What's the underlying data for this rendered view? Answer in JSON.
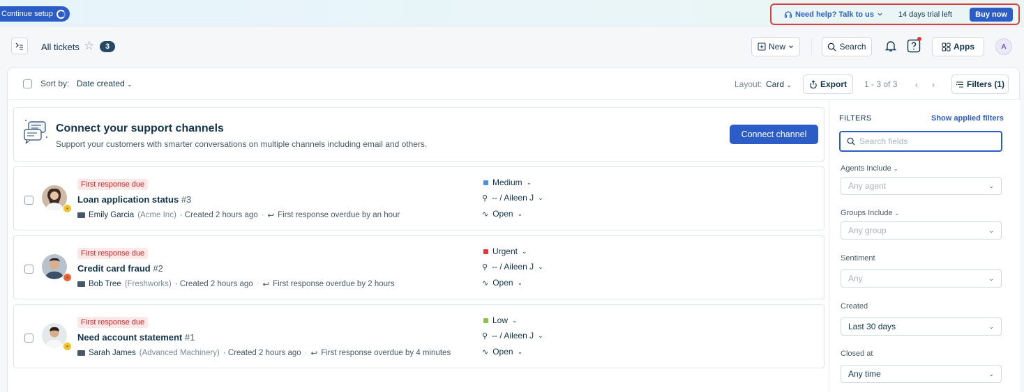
{
  "banner": {
    "continue_setup": "Continue setup",
    "help_link": "Need help? Talk to us",
    "trial_text": "14 days trial left",
    "buy_now": "Buy now"
  },
  "header": {
    "title": "All tickets",
    "count": "3",
    "new_label": "New",
    "search_label": "Search",
    "apps_label": "Apps",
    "avatar_initial": "A"
  },
  "toolbar": {
    "sort_label": "Sort by:",
    "sort_value": "Date created",
    "layout_label": "Layout:",
    "layout_value": "Card",
    "export_label": "Export",
    "pagination": "1 - 3 of 3",
    "filters_label": "Filters (1)"
  },
  "connect": {
    "title": "Connect your support channels",
    "subtitle": "Support your customers with smarter conversations on multiple channels including email and others.",
    "button": "Connect channel"
  },
  "tickets": [
    {
      "due": "First response due",
      "title": "Loan application status",
      "number": "#3",
      "requester": "Emily Garcia",
      "company": "(Acme Inc)",
      "created": "· Created 2 hours ago",
      "overdue": "First response overdue by an hour",
      "priority": "Medium",
      "priority_color": "#4a90e2",
      "assignee": "-- / Aileen J",
      "status": "Open",
      "sentiment_color": "#f2c230"
    },
    {
      "due": "First response due",
      "title": "Credit card fraud",
      "number": "#2",
      "requester": "Bob Tree",
      "company": "(Freshworks)",
      "created": "· Created 2 hours ago",
      "overdue": "First response overdue by 2 hours",
      "priority": "Urgent",
      "priority_color": "#e43538",
      "assignee": "-- / Aileen J",
      "status": "Open",
      "sentiment_color": "#e8663a"
    },
    {
      "due": "First response due",
      "title": "Need account statement",
      "number": "#1",
      "requester": "Sarah James",
      "company": "(Advanced Machinery)",
      "created": "· Created 2 hours ago",
      "overdue": "First response overdue by 4 minutes",
      "priority": "Low",
      "priority_color": "#8bc34a",
      "assignee": "-- / Aileen J",
      "status": "Open",
      "sentiment_color": "#f2c230"
    }
  ],
  "filters": {
    "heading": "FILTERS",
    "show_applied": "Show applied filters",
    "search_placeholder": "Search fields",
    "agents_label": "Agents Include",
    "agents_value": "Any agent",
    "groups_label": "Groups Include",
    "groups_value": "Any group",
    "sentiment_label": "Sentiment",
    "sentiment_value": "Any",
    "created_label": "Created",
    "created_value": "Last 30 days",
    "closed_label": "Closed at",
    "closed_value": "Any time"
  },
  "colors": {
    "accent": "#2c5cc5",
    "highlight_border": "#d93f3f",
    "due_bg": "#fde8e8",
    "due_text": "#c82124"
  },
  "icons": [
    "menu-toggle-icon",
    "star-icon",
    "plus-square-icon",
    "search-icon",
    "bell-icon",
    "help-question-icon",
    "apps-grid-icon",
    "export-icon",
    "filter-icon",
    "headset-icon",
    "chat-channels-icon",
    "mail-icon",
    "reply-icon",
    "person-icon",
    "activity-icon"
  ]
}
